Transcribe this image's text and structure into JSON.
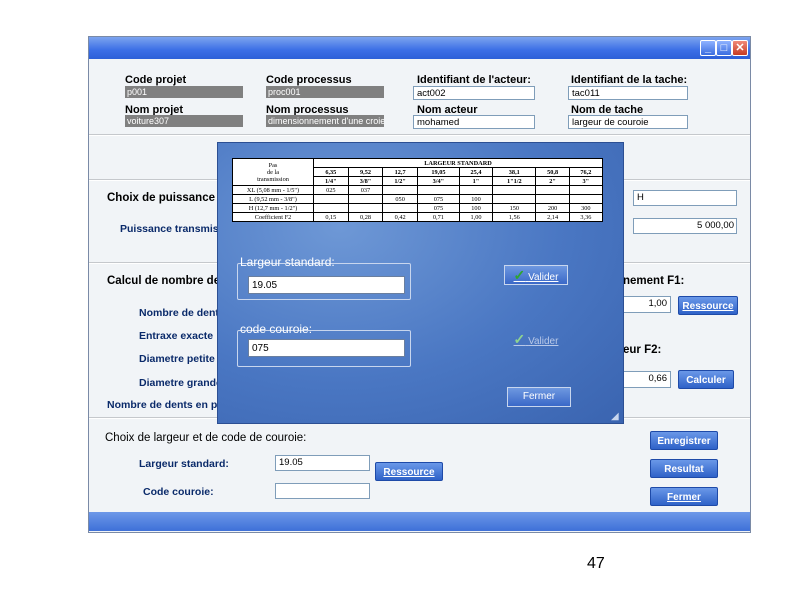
{
  "main": {
    "window_buttons": {
      "minimize": "_",
      "maximize": "□",
      "close": "✕"
    },
    "code_projet": {
      "label": "Code projet",
      "value": "p001"
    },
    "code_processus": {
      "label": "Code processus",
      "value": "proc001"
    },
    "identifiant_acteur": {
      "label": "Identifiant de l'acteur:",
      "value": "act002"
    },
    "identifiant_tache": {
      "label": "Identifiant de la tache:",
      "value": "tac011"
    },
    "nom_projet": {
      "label": "Nom projet",
      "value": "voiture307"
    },
    "nom_processus": {
      "label": "Nom processus",
      "value": "dimensionnement d'une croie"
    },
    "nom_acteur": {
      "label": "Nom acteur",
      "value": "mohamed"
    },
    "nom_tache": {
      "label": "Nom de tache",
      "value": "largeur de couroie"
    },
    "choix_puissance": {
      "label": "Choix de puissance ta",
      "right_value": "H"
    },
    "puissance_transmise": {
      "label": "Puissance transmissi",
      "value": "5 000,00"
    },
    "calcul_nombre": {
      "label": "Calcul de nombre de"
    },
    "nombre_dents": {
      "label": "Nombre de dent"
    },
    "entraxe": {
      "label": "Entraxe exacte :"
    },
    "diametre_petite": {
      "label": "Diametre petite"
    },
    "diametre_grande": {
      "label": "Diametre grande"
    },
    "nombre_dents_pr": {
      "label": "Nombre de dents en pr"
    },
    "f1": {
      "label": "nement F1:",
      "value": "1,00",
      "button": "Ressource"
    },
    "f2": {
      "label": "eur F2:",
      "value": "0,66",
      "button": "Calculer"
    },
    "choix_largeur": {
      "label": "Choix de largeur et de code de couroie:"
    },
    "largeur_standard": {
      "label": "Largeur standard:",
      "value": "19.05"
    },
    "code_couroie": {
      "label": "Code couroie:",
      "value": ""
    },
    "ressource_button": "Ressource",
    "enregistrer_button": "Enregistrer",
    "resultat_button": "Resultat",
    "fermer_button": "Fermer"
  },
  "dialog": {
    "table": {
      "header_pas": [
        "Pas",
        "de la",
        "transmission"
      ],
      "header_group": "LARGEUR STANDARD",
      "widths": [
        "6,35",
        "9,52",
        "12,7",
        "19,05",
        "25,4",
        "38,1",
        "50,8",
        "76,2"
      ],
      "inches": [
        "1/4\"",
        "3/8\"",
        "1/2\"",
        "3/4\"",
        "1\"",
        "1\"1/2",
        "2\"",
        "3\""
      ],
      "rows": [
        {
          "name": "XL (5,08 mm - 1/5\")",
          "cells": [
            "025",
            "037",
            "",
            "",
            "",
            "",
            "",
            ""
          ]
        },
        {
          "name": "L (9,52 mm - 3/8\")",
          "cells": [
            "",
            "",
            "050",
            "075",
            "100",
            "",
            "",
            ""
          ]
        },
        {
          "name": "H (12,7 mm - 1/2\")",
          "cells": [
            "",
            "",
            "",
            "075",
            "100",
            "150",
            "200",
            "300"
          ]
        },
        {
          "name": "Coefficient F2",
          "cells": [
            "0,15",
            "0,28",
            "0,42",
            "0,71",
            "1,00",
            "1,56",
            "2,14",
            "3,36"
          ]
        }
      ]
    },
    "largeur_group": {
      "label": "Largeur standard:",
      "value": "19.05"
    },
    "code_group": {
      "label": "code couroie:",
      "value": "075"
    },
    "valider1": "Valider",
    "valider2": "Valider",
    "fermer": "Fermer"
  },
  "page_number": "47"
}
